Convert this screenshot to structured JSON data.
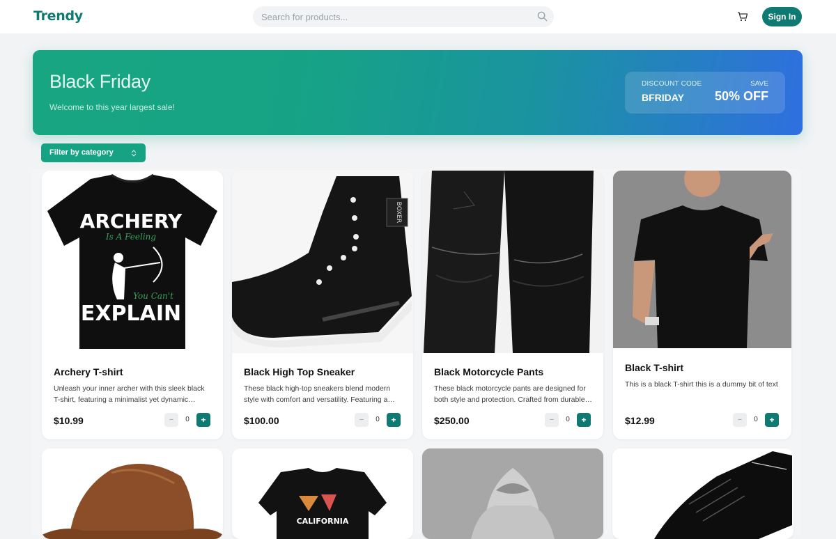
{
  "header": {
    "logo": "Trendy",
    "search_placeholder": "Search for products...",
    "sign_in_label": "Sign In",
    "icons": {
      "search": "search-icon",
      "cart": "cart-icon"
    }
  },
  "banner": {
    "title": "Black Friday",
    "subtitle": "Welcome to this year largest sale!",
    "discount_label": "DISCOUNT CODE",
    "discount_code": "BFRIDAY",
    "save_label": "SAVE",
    "save_value": "50% OFF"
  },
  "filter": {
    "label": "Filter by category"
  },
  "colors": {
    "brand": "#0e7a72",
    "accent": "#16a384",
    "banner_end": "#2f6fe0"
  },
  "products": [
    {
      "name": "Archery T-shirt",
      "description": "Unleash your inner archer with this sleek black T-shirt, featuring a minimalist yet dynamic design...",
      "price": "$10.99",
      "qty": "0"
    },
    {
      "name": "Black High Top Sneaker",
      "description": "These black high-top sneakers blend modern style with comfort and versatility. Featuring a durable design...",
      "price": "$100.00",
      "qty": "0"
    },
    {
      "name": "Black Motorcycle Pants",
      "description": "These black motorcycle pants are designed for both style and protection. Crafted from durable leather...",
      "price": "$250.00",
      "qty": "0"
    },
    {
      "name": "Black T-shirt",
      "description": "This is a black T-shirt this is a dummy bit of text",
      "price": "$12.99",
      "qty": "0"
    }
  ],
  "row2_images": [
    "brown-cowboy-hat",
    "california-t-shirt",
    "grey-hoodie",
    "black-dress-shoe"
  ],
  "t_shirt_print": {
    "line1": "ARCHERY",
    "line2": "Is A Feeling",
    "line3": "You Can't",
    "line4": "EXPLAIN"
  },
  "sneaker_tag": "BOXER",
  "tshirt2_print": "CALIFORNIA"
}
